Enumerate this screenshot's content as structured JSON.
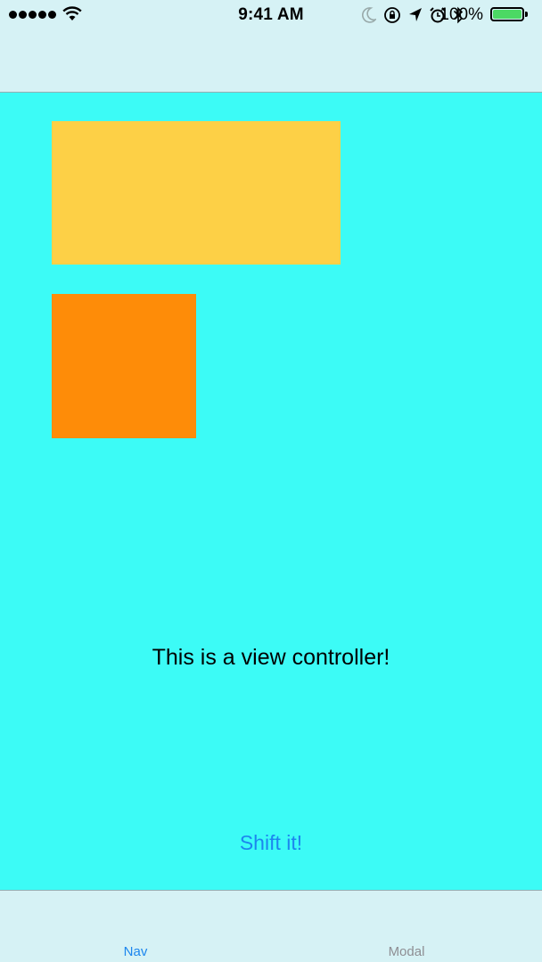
{
  "status_bar": {
    "time": "9:41 AM",
    "battery_percent": "100%",
    "signal_bars": 5,
    "icons": [
      "wifi-icon",
      "moon-icon",
      "orientation-lock-icon",
      "location-icon",
      "alarm-icon",
      "bluetooth-icon",
      "battery-icon"
    ],
    "battery_color": "#4cd964"
  },
  "colors": {
    "background": "#3cfbf6",
    "bar_background": "#d6f2f5",
    "yellow_box": "#fdd046",
    "orange_box": "#fe8c08",
    "accent": "#1c86ee",
    "inactive_tab": "#8e8e93"
  },
  "main": {
    "message": "This is a view controller!",
    "shift_button_label": "Shift it!"
  },
  "tab_bar": {
    "tabs": [
      {
        "label": "Nav",
        "selected": true
      },
      {
        "label": "Modal",
        "selected": false
      }
    ]
  }
}
